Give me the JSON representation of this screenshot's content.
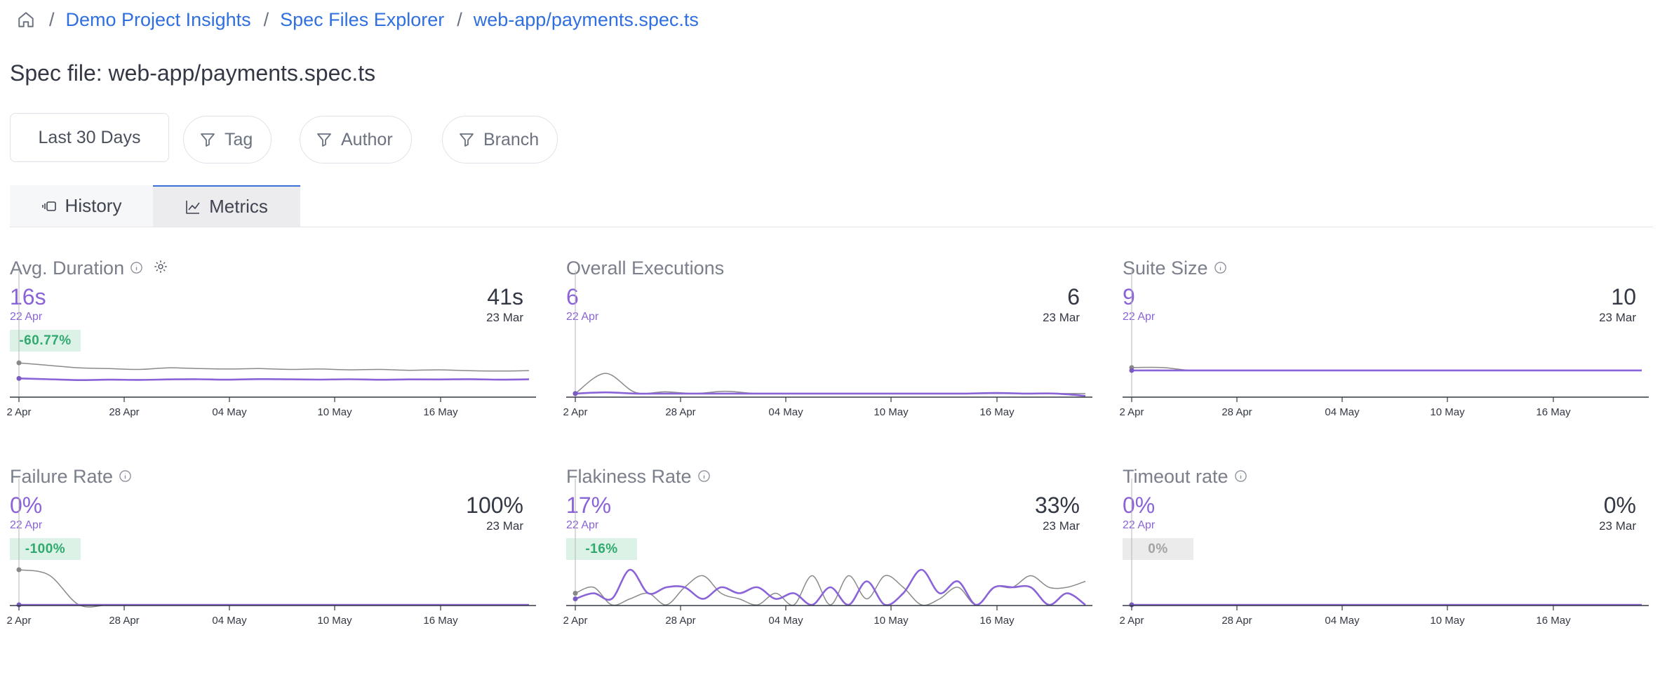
{
  "breadcrumb": {
    "home_icon": "home-icon",
    "items": [
      "Demo Project Insights",
      "Spec Files Explorer",
      "web-app/payments.spec.ts"
    ],
    "separator": "/"
  },
  "page_title": "Spec file: web-app/payments.spec.ts",
  "filters": {
    "date_range": "Last 30 Days",
    "tag": "Tag",
    "author": "Author",
    "branch": "Branch",
    "filter_icon": "filter-icon"
  },
  "tabs": {
    "history": "History",
    "metrics": "Metrics",
    "active": "Metrics"
  },
  "colors": {
    "current_series": "#8b63d8",
    "previous_series": "#8a8a8a",
    "link": "#2f6fe0",
    "delta_bg": "#ddf2e7",
    "delta_text": "#2faa6f"
  },
  "x_axis_ticks": [
    "2 Apr",
    "28 Apr",
    "04 May",
    "10 May",
    "16 May"
  ],
  "panels": [
    {
      "title": "Avg. Duration",
      "info": true,
      "gear": true,
      "current": "16s",
      "current_date": "22 Apr",
      "previous": "41s",
      "previous_date": "23 Mar",
      "delta": "-60.77%",
      "delta_style": "good"
    },
    {
      "title": "Overall Executions",
      "info": false,
      "gear": false,
      "current": "6",
      "current_date": "22 Apr",
      "previous": "6",
      "previous_date": "23 Mar",
      "delta": "",
      "delta_style": "none"
    },
    {
      "title": "Suite Size",
      "info": true,
      "gear": false,
      "current": "9",
      "current_date": "22 Apr",
      "previous": "10",
      "previous_date": "23 Mar",
      "delta": "",
      "delta_style": "none"
    },
    {
      "title": "Failure Rate",
      "info": true,
      "gear": false,
      "current": "0%",
      "current_date": "22 Apr",
      "previous": "100%",
      "previous_date": "23 Mar",
      "delta": "-100%",
      "delta_style": "good"
    },
    {
      "title": "Flakiness Rate",
      "info": true,
      "gear": false,
      "current": "17%",
      "current_date": "22 Apr",
      "previous": "33%",
      "previous_date": "23 Mar",
      "delta": "-16%",
      "delta_style": "good"
    },
    {
      "title": "Timeout rate",
      "info": true,
      "gear": false,
      "current": "0%",
      "current_date": "22 Apr",
      "previous": "0%",
      "previous_date": "23 Mar",
      "delta": "0%",
      "delta_style": "neutral"
    }
  ],
  "chart_data": [
    {
      "type": "line",
      "title": "Avg. Duration",
      "x_ticks": [
        "2 Apr",
        "28 Apr",
        "04 May",
        "10 May",
        "16 May"
      ],
      "series": [
        {
          "values": [
            22,
            21,
            20,
            20.5,
            20.2,
            20.8,
            21,
            20.5,
            21.2,
            20.9,
            20.6,
            21,
            20.4,
            20.8,
            20.7,
            21.1,
            20.5,
            20.9
          ]
        },
        {
          "values": [
            41,
            38,
            35,
            34,
            33,
            35,
            34,
            33.5,
            34,
            33,
            33.5,
            32.5,
            33,
            32,
            32.5,
            31.5,
            31,
            31.5
          ]
        }
      ]
    },
    {
      "type": "line",
      "title": "Overall Executions",
      "x_ticks": [
        "2 Apr",
        "28 Apr",
        "04 May",
        "10 May",
        "16 May"
      ],
      "series": [
        {
          "values": [
            6,
            6.2,
            6,
            6,
            6,
            6,
            6,
            6,
            6,
            6,
            6,
            6,
            6,
            6,
            6.1,
            6,
            6,
            5.6
          ]
        },
        {
          "values": [
            6,
            9.5,
            6.2,
            6.3,
            6,
            6.4,
            6,
            6,
            6,
            6,
            6,
            6,
            6,
            6,
            6,
            6,
            6,
            6
          ]
        }
      ]
    },
    {
      "type": "line",
      "title": "Suite Size",
      "x_ticks": [
        "2 Apr",
        "28 Apr",
        "04 May",
        "10 May",
        "16 May"
      ],
      "series": [
        {
          "values": [
            9,
            9,
            9,
            9,
            9,
            9,
            9,
            9,
            9,
            9,
            9,
            9,
            9,
            9,
            9,
            9,
            9,
            9
          ]
        },
        {
          "values": [
            10,
            10,
            9,
            9,
            9,
            9,
            9,
            9,
            9,
            9,
            9,
            9,
            9,
            9,
            9,
            9,
            9,
            9
          ]
        }
      ]
    },
    {
      "type": "line",
      "title": "Failure Rate",
      "x_ticks": [
        "2 Apr",
        "28 Apr",
        "04 May",
        "10 May",
        "16 May"
      ],
      "series": [
        {
          "values": [
            0,
            0,
            0,
            0,
            0,
            0,
            0,
            0,
            0,
            0,
            0,
            0,
            0,
            0,
            0,
            0,
            0,
            0
          ]
        },
        {
          "values": [
            100,
            85,
            0,
            0,
            0,
            0,
            0,
            0,
            0,
            0,
            0,
            0,
            0,
            0,
            0,
            0,
            0,
            0
          ]
        }
      ]
    },
    {
      "type": "line",
      "title": "Flakiness Rate",
      "x_ticks": [
        "2 Apr",
        "28 Apr",
        "04 May",
        "10 May",
        "16 May"
      ],
      "series": [
        {
          "values": [
            17,
            33,
            17,
            100,
            33,
            50,
            50,
            17,
            50,
            33,
            50,
            17,
            33,
            0,
            50,
            0,
            67,
            0,
            33,
            100,
            33,
            67,
            0,
            50,
            50,
            50,
            0,
            33,
            0
          ]
        },
        {
          "values": [
            33,
            50,
            0,
            17,
            33,
            0,
            50,
            83,
            33,
            17,
            0,
            33,
            0,
            83,
            0,
            83,
            17,
            83,
            50,
            0,
            17,
            50,
            0,
            50,
            50,
            83,
            50,
            50,
            67
          ]
        }
      ]
    },
    {
      "type": "line",
      "title": "Timeout rate",
      "x_ticks": [
        "2 Apr",
        "28 Apr",
        "04 May",
        "10 May",
        "16 May"
      ],
      "series": [
        {
          "values": [
            0,
            0,
            0,
            0,
            0,
            0,
            0,
            0,
            0,
            0,
            0,
            0,
            0,
            0,
            0,
            0,
            0,
            0
          ]
        },
        {
          "values": [
            0,
            0,
            0,
            0,
            0,
            0,
            0,
            0,
            0,
            0,
            0,
            0,
            0,
            0,
            0,
            0,
            0,
            0
          ]
        }
      ]
    }
  ]
}
